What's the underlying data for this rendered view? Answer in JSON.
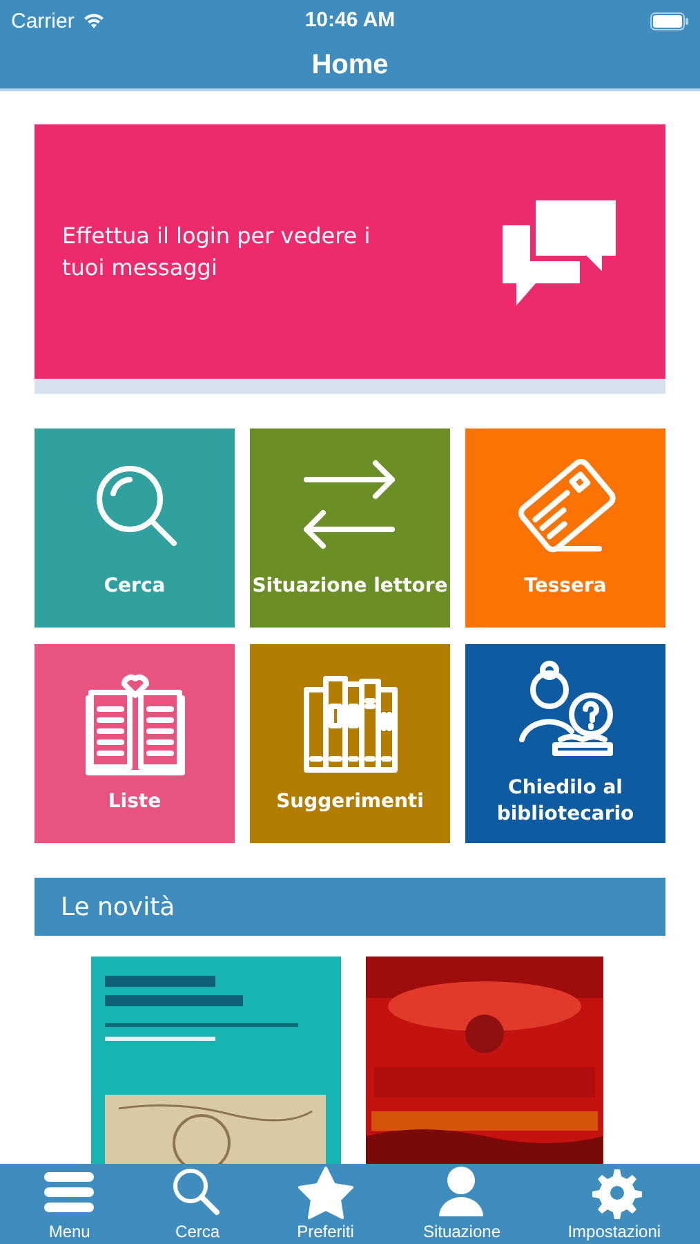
{
  "status_bar": {
    "carrier": "Carrier",
    "time": "10:46 AM"
  },
  "nav_bar": {
    "title": "Home"
  },
  "banner": {
    "text": "Effettua il login per vedere i tuoi messaggi"
  },
  "tiles": [
    {
      "label": "Cerca",
      "kind": "search",
      "color": "#31a19f"
    },
    {
      "label": "Situazione lettore",
      "kind": "exchange",
      "color": "#6b8f26"
    },
    {
      "label": "Tessera",
      "kind": "card",
      "color": "#fb7305"
    },
    {
      "label": "Liste",
      "kind": "book",
      "color": "#e9537f"
    },
    {
      "label": "Suggerimenti",
      "kind": "shelf",
      "color": "#b27d00"
    },
    {
      "label": "Chiedilo al bibliotecario",
      "kind": "librarian",
      "color": "#0f5ba1"
    }
  ],
  "news": {
    "title": "Le novità"
  },
  "tab_bar": [
    {
      "label": "Menu",
      "kind": "menu"
    },
    {
      "label": "Cerca",
      "kind": "search"
    },
    {
      "label": "Preferiti",
      "kind": "star"
    },
    {
      "label": "Situazione",
      "kind": "person"
    },
    {
      "label": "Impostazioni",
      "kind": "gear"
    }
  ]
}
